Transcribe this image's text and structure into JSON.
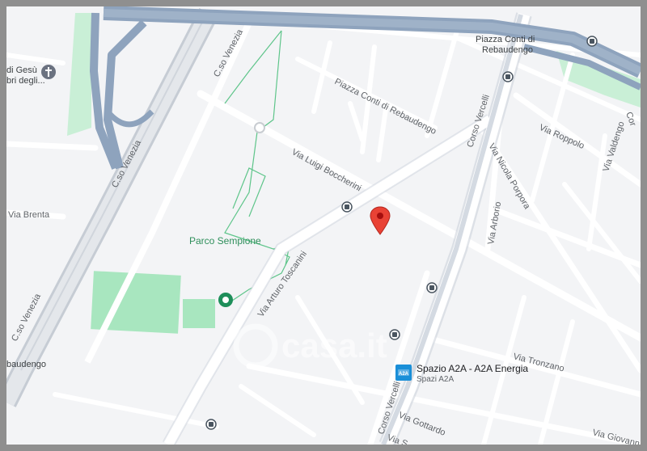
{
  "map": {
    "watermark": "casa.it",
    "park_label": "Parco Sempione",
    "poi": {
      "name": "Spazio A2A - A2A Energia",
      "subtitle": "Spazi A2A",
      "icon": "a2a-logo-icon",
      "icon_text": "A2A"
    },
    "streets": {
      "c_so_venezia_top": "C.so Venezia",
      "c_so_venezia_mid": "C.so Venezia",
      "c_so_venezia_low": "C.so Venezia",
      "via_brenta": "Via Brenta",
      "via_luigi_boccherini": "Via Luigi Boccherini",
      "via_arturo_toscanini": "Via Arturo Toscanini",
      "piazza_conti_top": "Piazza Conti di",
      "piazza_conti_top2": "Rebaudengo",
      "piazza_conti_diag": "Piazza Conti di Rebaudengo",
      "corso_vercelli_top": "Corso Vercelli",
      "corso_vercelli_bottom": "Corso Vercelli",
      "via_nicola_porpora": "Via Nicola Porpora",
      "via_arborio": "Via Arborio",
      "via_roppolo": "Via Roppolo",
      "via_valdengo": "Via Valdengo",
      "via_tronzano": "Via Tronzano",
      "via_gottardo": "Via Gottardo",
      "via_giovanni": "Via Giovann",
      "via_s": "Via S",
      "corso_edge": "Cor",
      "rebaudengo_left": "baudengo",
      "chiesa_line1": "di Gesù",
      "chiesa_line2": "bri degli..."
    },
    "colors": {
      "highway": "#8ea3bd",
      "park": "#a8e6bf",
      "road": "#ffffff",
      "pin": "#e94235",
      "transit": "#4a5560"
    }
  }
}
